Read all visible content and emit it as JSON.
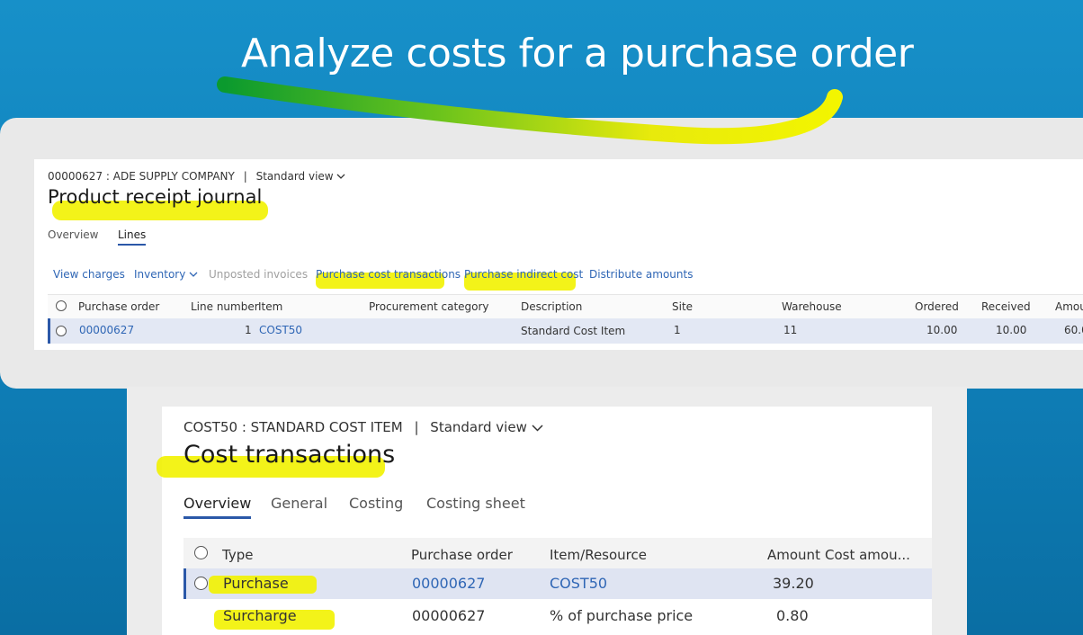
{
  "headline": "Analyze costs for a purchase order",
  "colors": {
    "background": "#1790c9",
    "accent": "#2b58a8",
    "link": "#2f66b5",
    "highlight": "#f2f200"
  },
  "receipt": {
    "breadcrumb": "00000627 : ADE SUPPLY COMPANY",
    "separator": "|",
    "view": "Standard view",
    "title": "Product receipt journal",
    "tabs": [
      "Overview",
      "Lines"
    ],
    "active_tab": "Lines",
    "actions": {
      "view_charges": "View charges",
      "inventory": "Inventory",
      "unposted_invoices": "Unposted invoices",
      "purchase_cost_transactions": "Purchase cost transactions",
      "purchase_indirect_cost": "Purchase indirect cost",
      "distribute_amounts": "Distribute amounts"
    },
    "columns": [
      "Purchase order",
      "Line number",
      "Item",
      "Procurement category",
      "Description",
      "Site",
      "Warehouse",
      "Ordered",
      "Received",
      "Amou"
    ],
    "rows": [
      {
        "purchase_order": "00000627",
        "line_number": "1",
        "item": "COST50",
        "procurement_category": "",
        "description": "Standard Cost Item",
        "site": "1",
        "warehouse": "11",
        "ordered": "10.00",
        "received": "10.00",
        "amount": "60.0"
      }
    ]
  },
  "cost": {
    "breadcrumb": "COST50 : STANDARD COST ITEM",
    "separator": "|",
    "view": "Standard view",
    "title": "Cost transactions",
    "tabs": [
      "Overview",
      "General",
      "Costing",
      "Costing sheet"
    ],
    "active_tab": "Overview",
    "columns": [
      "Type",
      "Purchase order",
      "Item/Resource",
      "Amount",
      "Cost amou..."
    ],
    "rows": [
      {
        "type": "Purchase",
        "purchase_order": "00000627",
        "item_resource": "COST50",
        "amount": "39.20",
        "cost_amount": ""
      },
      {
        "type": "Surcharge",
        "purchase_order": "00000627",
        "item_resource": "% of purchase price",
        "amount": "0.80",
        "cost_amount": ""
      }
    ]
  }
}
